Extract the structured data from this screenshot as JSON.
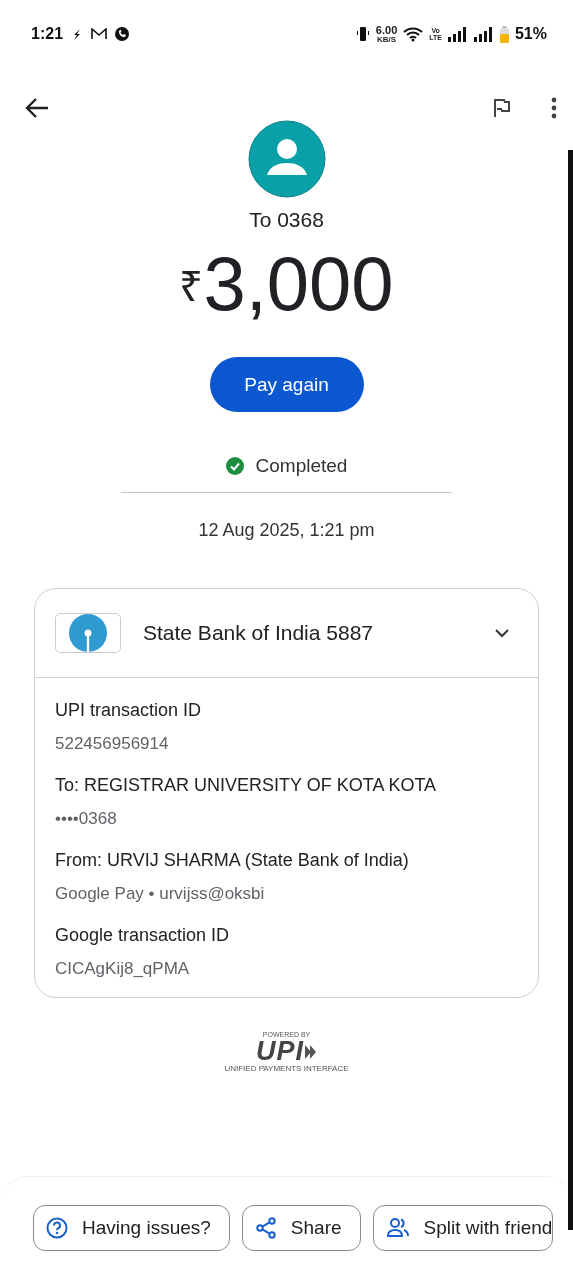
{
  "status_bar": {
    "time": "1:21",
    "speed": "6.00",
    "speed_unit": "KB/S",
    "volte_top": "Vo",
    "volte_bottom": "LTE",
    "battery": "51%"
  },
  "payee": {
    "title": "To 0368",
    "amount_symbol": "₹",
    "amount": "3,000"
  },
  "pay_again": "Pay again",
  "status": {
    "label": "Completed",
    "kind": "completed"
  },
  "date": "12 Aug 2025, 1:21 pm",
  "account": {
    "name": "State Bank of India 5887",
    "expanded": true
  },
  "details": [
    {
      "label": "UPI transaction ID",
      "value": "522456956914"
    },
    {
      "label": "To: REGISTRAR UNIVERSITY OF KOTA KOTA",
      "value": "••••0368"
    },
    {
      "label": "From: URVIJ  SHARMA (State Bank of India)",
      "value": "Google Pay • urvijss@oksbi"
    },
    {
      "label": "Google transaction ID",
      "value": "CICAgKij8_qPMA"
    }
  ],
  "upi": {
    "powered_by": "POWERED BY",
    "logo": "UPI",
    "tagline": "UNIFIED PAYMENTS INTERFACE"
  },
  "actions": [
    {
      "kind": "help",
      "label": "Having issues?"
    },
    {
      "kind": "share",
      "label": "Share"
    },
    {
      "kind": "split",
      "label": "Split with friend"
    }
  ]
}
